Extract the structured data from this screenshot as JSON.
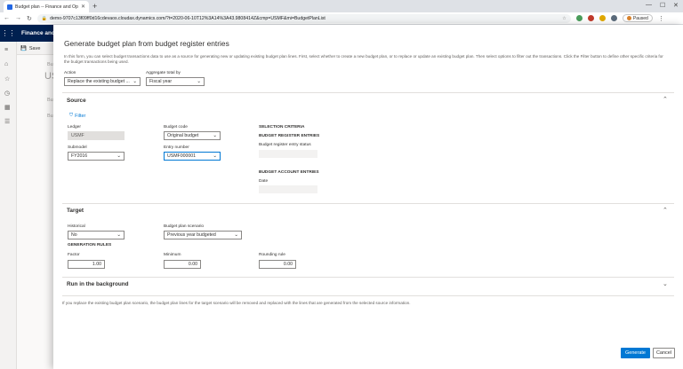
{
  "browser": {
    "tab_title": "Budget plan -- Finance and Ope...",
    "url": "demo-9707c13f09ff0d16cdevaos.cloudax.dynamics.com/?t=2020-06-10T12%3A14%3A43.9808414Z&cmp=USMF&mi=BudgetPlanList",
    "profile_label": "Paused"
  },
  "app": {
    "name": "Finance and",
    "bg_save": "Save",
    "bg_texts": [
      "Bud",
      "USM",
      "Bud",
      "Bud"
    ]
  },
  "dialog": {
    "title": "Generate budget plan from budget register entries",
    "intro": "In this form, you can select budget transactions data to use as a source for generating new or updating existing budget plan lines. First, select whether to create a new budget plan, or to replace or update an existing budget plan. Then select options to filter out the transactions. Click the Filter button to define other specific criteria for the budget transactions being used.",
    "action": {
      "label": "Action",
      "value": "Replace the existing budget ..."
    },
    "aggregate": {
      "label": "Aggregate total by",
      "value": "Fiscal year"
    },
    "source": {
      "heading": "Source",
      "filter_label": "Filter",
      "ledger": {
        "label": "Ledger",
        "value": "USMF"
      },
      "budget_code": {
        "label": "Budget code",
        "value": "Original budget"
      },
      "submodel": {
        "label": "Submodel",
        "value": "FY2016"
      },
      "entry_number": {
        "label": "Entry number",
        "value": "USMF000001"
      },
      "criteria": {
        "heading": "SELECTION CRITERIA",
        "register_heading": "BUDGET REGISTER ENTRIES",
        "register_status_label": "Budget register entry status",
        "account_heading": "BUDGET ACCOUNT ENTRIES",
        "date_label": "Date"
      }
    },
    "target": {
      "heading": "Target",
      "historical": {
        "label": "Historical",
        "value": "No"
      },
      "scenario": {
        "label": "Budget plan scenario",
        "value": "Previous year budgeted"
      },
      "rules_heading": "GENERATION RULES",
      "factor": {
        "label": "Factor",
        "value": "1.00"
      },
      "minimum": {
        "label": "Minimum",
        "value": "0.00"
      },
      "rounding": {
        "label": "Rounding rule",
        "value": "0.00"
      }
    },
    "background": {
      "heading": "Run in the background"
    },
    "footnote": "If you replace the existing budget plan scenario, the budget plan lines for the target scenario will be removed and replaced with the lines that are generated from the selected source information.",
    "generate_label": "Generate",
    "cancel_label": "Cancel"
  },
  "colors": {
    "accent": "#0078d4",
    "app_header": "#002050"
  }
}
